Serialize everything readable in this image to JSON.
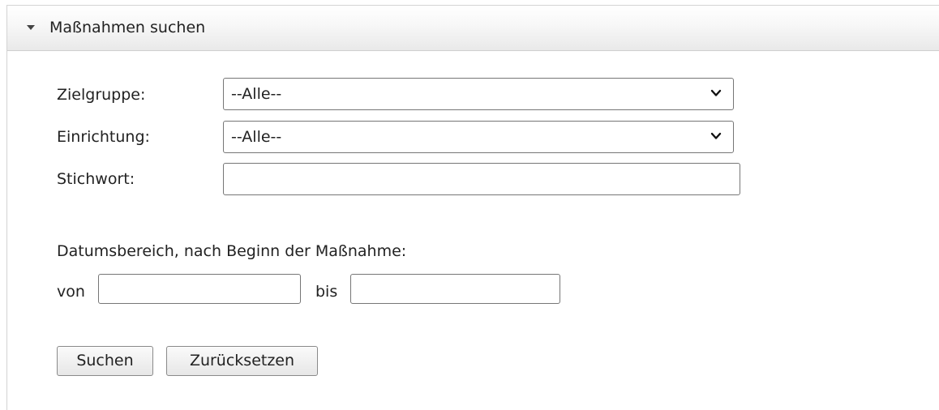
{
  "panel": {
    "title": "Maßnahmen suchen",
    "collapse_icon": "triangle-down-icon"
  },
  "form": {
    "zielgruppe": {
      "label": "Zielgruppe:",
      "selected": "--Alle--"
    },
    "einrichtung": {
      "label": "Einrichtung:",
      "selected": "--Alle--"
    },
    "stichwort": {
      "label": "Stichwort:",
      "value": ""
    },
    "date_range": {
      "heading": "Datumsbereich, nach Beginn der Maßnahme:",
      "from_label": "von",
      "from_value": "",
      "to_label": "bis",
      "to_value": ""
    }
  },
  "buttons": {
    "search": "Suchen",
    "reset": "Zurücksetzen"
  }
}
